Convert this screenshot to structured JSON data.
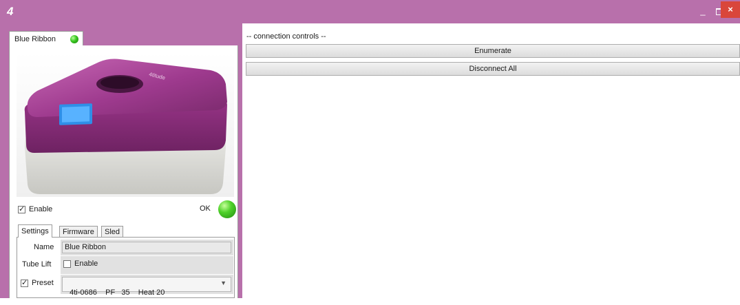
{
  "window": {
    "app_icon_glyph": "4",
    "minimize_glyph": "_",
    "close_glyph": "×",
    "title_color": "#b870ab",
    "close_color": "#d9463b"
  },
  "device_tab": {
    "label": "Blue Ribbon",
    "status": "connected"
  },
  "device": {
    "enable_label": "Enable",
    "enable_checked": true,
    "ok_label": "OK",
    "status_color": "#37c51f"
  },
  "tabs": [
    "Settings",
    "Firmware",
    "Sled"
  ],
  "settings": {
    "name_label": "Name",
    "name_value": "Blue Ribbon",
    "tube_lift_label": "Tube Lift",
    "tube_lift_enable_label": "Enable",
    "tube_lift_checked": false,
    "preset_label": "Preset",
    "preset_checked": true,
    "preset_value": "4ti-0686    PF   35    Heat 20"
  },
  "connection": {
    "title": "-- connection controls --",
    "enumerate_label": "Enumerate",
    "disconnect_all_label": "Disconnect All"
  }
}
